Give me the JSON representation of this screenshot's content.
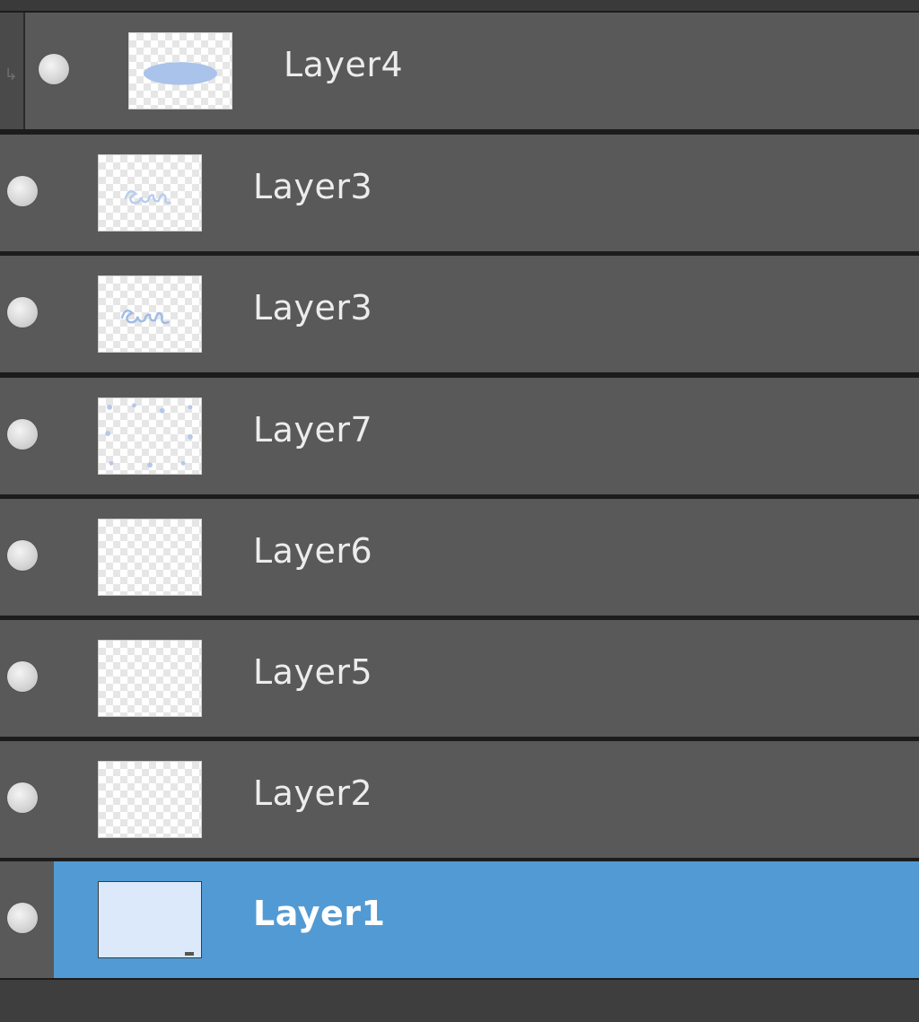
{
  "panel": {
    "layers": [
      {
        "name": "Layer4",
        "thumbnail": "ellipse-shape",
        "visible": true,
        "clipped": true,
        "selected": false
      },
      {
        "name": "Layer3",
        "thumbnail": "scribble-text",
        "visible": true,
        "clipped": false,
        "selected": false
      },
      {
        "name": "Layer3",
        "thumbnail": "scribble-text",
        "visible": true,
        "clipped": false,
        "selected": false
      },
      {
        "name": "Layer7",
        "thumbnail": "scattered-dots",
        "visible": true,
        "clipped": false,
        "selected": false
      },
      {
        "name": "Layer6",
        "thumbnail": "transparent",
        "visible": true,
        "clipped": false,
        "selected": false
      },
      {
        "name": "Layer5",
        "thumbnail": "transparent",
        "visible": true,
        "clipped": false,
        "selected": false
      },
      {
        "name": "Layer2",
        "thumbnail": "transparent",
        "visible": true,
        "clipped": false,
        "selected": false
      },
      {
        "name": "Layer1",
        "thumbnail": "solid-light-blue",
        "visible": true,
        "clipped": false,
        "selected": true
      }
    ]
  },
  "colors": {
    "row_bg": "#595959",
    "selected_bg": "#529ad3",
    "text": "#ececec",
    "thumb_paint": "#a9c3ea",
    "layer1_fill": "#dce9fb"
  },
  "icons": {
    "visibility": "eye-dot-icon",
    "clip": "clip-arrow-icon"
  }
}
